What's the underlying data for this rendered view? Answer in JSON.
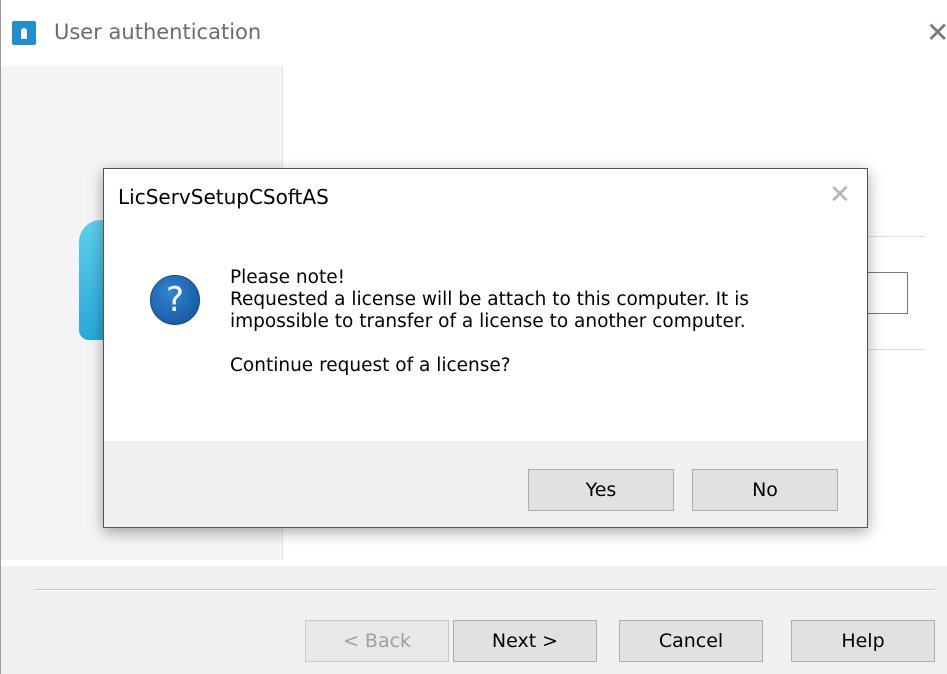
{
  "outer_window": {
    "title": "User authentication",
    "close_glyph": "✕",
    "app_icon": "key-lock-icon",
    "buttons": {
      "back": "< Back",
      "next": "Next >",
      "cancel": "Cancel",
      "help": "Help"
    }
  },
  "dialog": {
    "title": "LicServSetupCSoftAS",
    "close_glyph": "✕",
    "icon": "question-icon",
    "icon_glyph": "?",
    "message": {
      "line1": "Please note!",
      "line2": "Requested a license will be attach to this computer. It is",
      "line3": "impossible to transfer of a license to another computer.",
      "line4": "Continue request of a license?"
    },
    "buttons": {
      "yes": "Yes",
      "no": "No"
    }
  },
  "colors": {
    "accent_blue": "#1f8fd0",
    "question_icon_blue": "#1a5fa8",
    "window_bg": "#f0f0f0",
    "button_bg": "#e1e1e1"
  }
}
